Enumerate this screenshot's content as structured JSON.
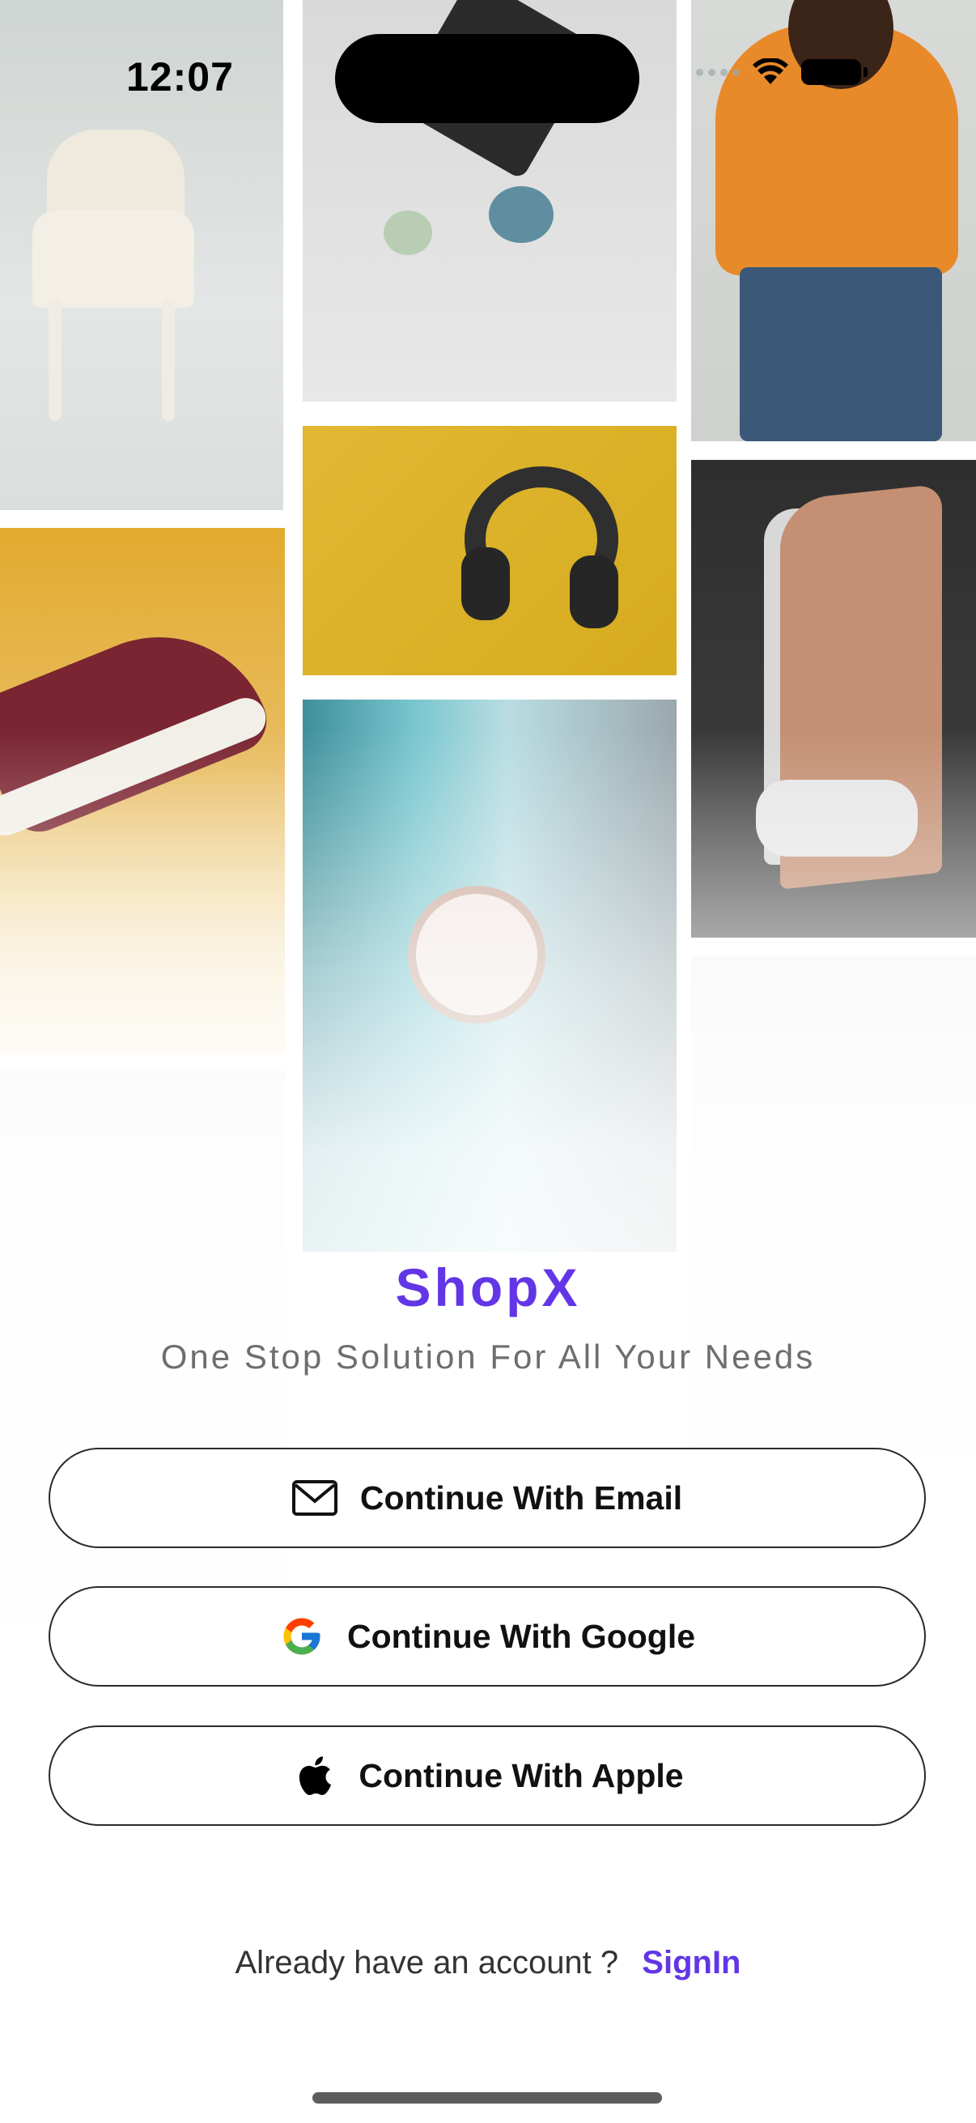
{
  "status_bar": {
    "time": "12:07"
  },
  "collage": {
    "tiles": [
      "chair",
      "stones-and-band",
      "woman-orange-sweater",
      "headphones",
      "sneaker",
      "ps5-console",
      "wristwatch",
      "person",
      "products"
    ]
  },
  "brand": {
    "name": "ShopX",
    "tagline": "One Stop Solution For All Your Needs"
  },
  "auth": {
    "email_label": "Continue With Email",
    "google_label": "Continue With Google",
    "apple_label": "Continue With Apple"
  },
  "signin": {
    "prompt": "Already have an account ?",
    "link": "SignIn"
  },
  "colors": {
    "accent": "#6236e6",
    "button_border": "#2a2a2a",
    "text": "#111111",
    "muted": "#6e6e6e"
  },
  "icons": {
    "email": "envelope-icon",
    "google": "google-logo-icon",
    "apple": "apple-logo-icon"
  }
}
